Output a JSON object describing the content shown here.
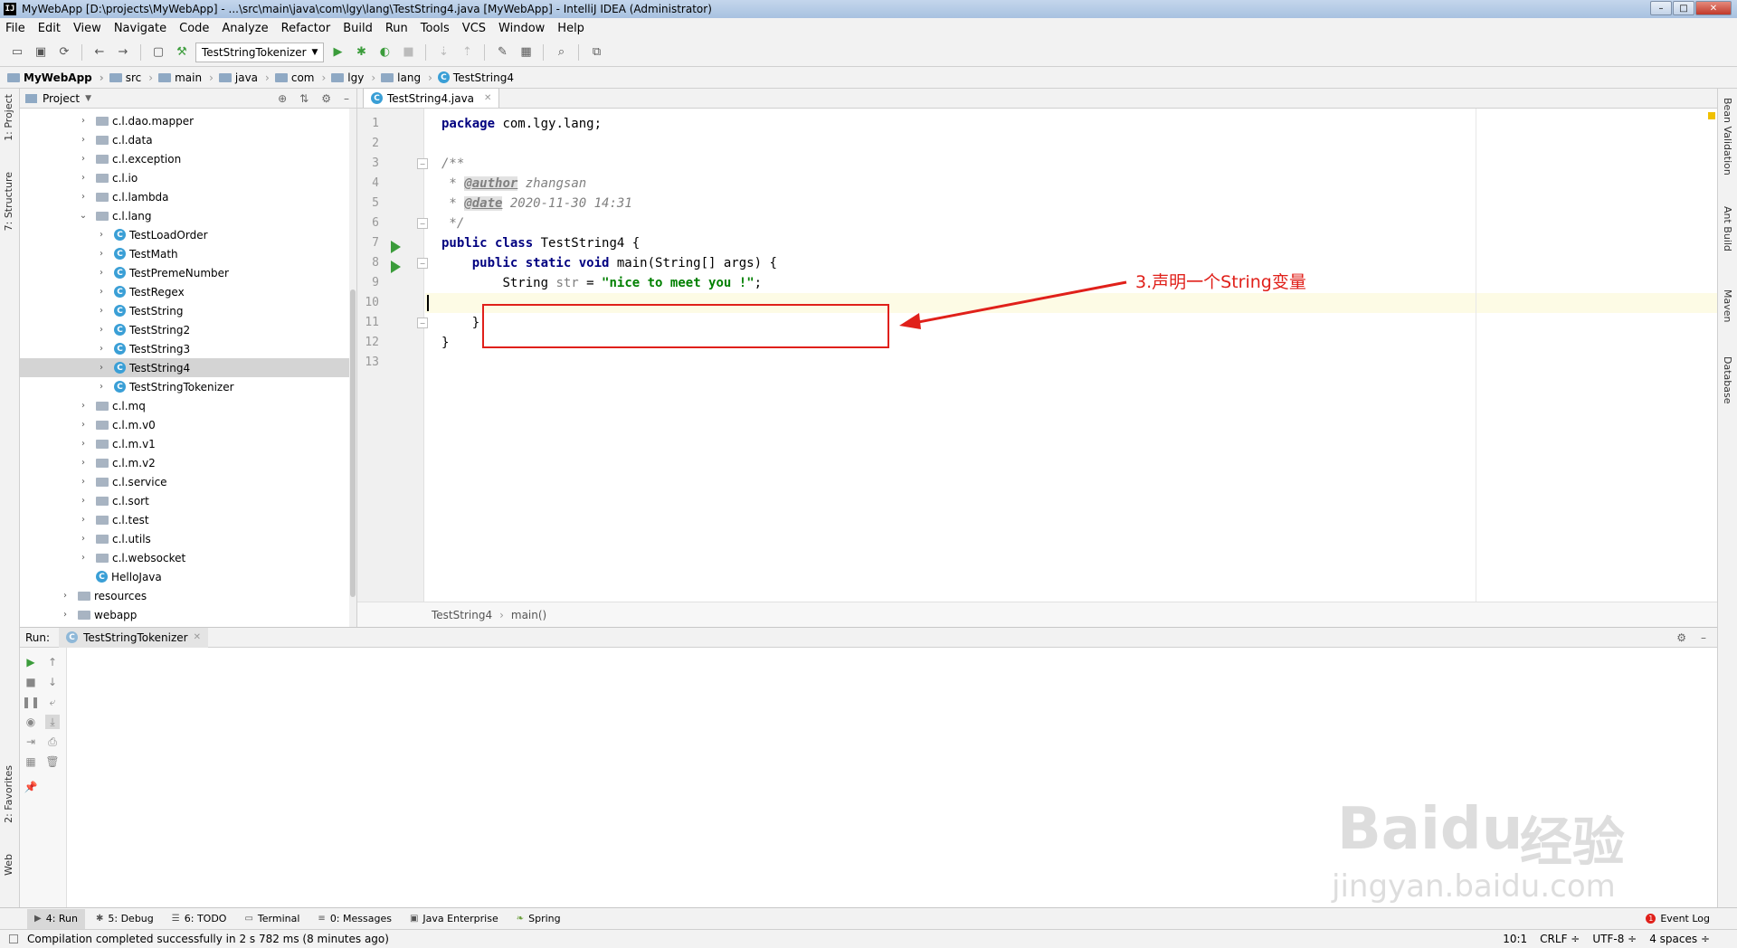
{
  "window": {
    "title": "MyWebApp [D:\\projects\\MyWebApp] - ...\\src\\main\\java\\com\\lgy\\lang\\TestString4.java [MyWebApp] - IntelliJ IDEA (Administrator)"
  },
  "menu": [
    "File",
    "Edit",
    "View",
    "Navigate",
    "Code",
    "Analyze",
    "Refactor",
    "Build",
    "Run",
    "Tools",
    "VCS",
    "Window",
    "Help"
  ],
  "toolbar": {
    "run_config": "TestStringTokenizer"
  },
  "breadcrumbs": [
    "MyWebApp",
    "src",
    "main",
    "java",
    "com",
    "lgy",
    "lang",
    "TestString4"
  ],
  "left_tabs": {
    "project": "1: Project",
    "structure": "7: Structure",
    "favorites": "2: Favorites",
    "web": "Web"
  },
  "right_tabs": [
    "Bean Validation",
    "Ant Build",
    "Maven",
    "Database"
  ],
  "project_panel": {
    "title": "Project",
    "items": [
      {
        "label": "c.l.dao.mapper",
        "type": "package",
        "indent": 1
      },
      {
        "label": "c.l.data",
        "type": "package",
        "indent": 1
      },
      {
        "label": "c.l.exception",
        "type": "package",
        "indent": 1
      },
      {
        "label": "c.l.io",
        "type": "package",
        "indent": 1
      },
      {
        "label": "c.l.lambda",
        "type": "package",
        "indent": 1
      },
      {
        "label": "c.l.lang",
        "type": "package",
        "indent": 1,
        "expanded": true
      },
      {
        "label": "TestLoadOrder",
        "type": "class",
        "indent": 2
      },
      {
        "label": "TestMath",
        "type": "class",
        "indent": 2
      },
      {
        "label": "TestPremeNumber",
        "type": "class",
        "indent": 2
      },
      {
        "label": "TestRegex",
        "type": "class",
        "indent": 2
      },
      {
        "label": "TestString",
        "type": "class",
        "indent": 2
      },
      {
        "label": "TestString2",
        "type": "class",
        "indent": 2
      },
      {
        "label": "TestString3",
        "type": "class",
        "indent": 2
      },
      {
        "label": "TestString4",
        "type": "class",
        "indent": 2,
        "selected": true
      },
      {
        "label": "TestStringTokenizer",
        "type": "class",
        "indent": 2
      },
      {
        "label": "c.l.mq",
        "type": "package",
        "indent": 1
      },
      {
        "label": "c.l.m.v0",
        "type": "package",
        "indent": 1
      },
      {
        "label": "c.l.m.v1",
        "type": "package",
        "indent": 1
      },
      {
        "label": "c.l.m.v2",
        "type": "package",
        "indent": 1
      },
      {
        "label": "c.l.service",
        "type": "package",
        "indent": 1
      },
      {
        "label": "c.l.sort",
        "type": "package",
        "indent": 1
      },
      {
        "label": "c.l.test",
        "type": "package",
        "indent": 1
      },
      {
        "label": "c.l.utils",
        "type": "package",
        "indent": 1
      },
      {
        "label": "c.l.websocket",
        "type": "package",
        "indent": 1
      },
      {
        "label": "HelloJava",
        "type": "class",
        "indent": 1,
        "nochevron": true
      },
      {
        "label": "resources",
        "type": "package",
        "indent": 0
      },
      {
        "label": "webapp",
        "type": "package",
        "indent": 0
      }
    ]
  },
  "editor": {
    "tab": "TestString4.java",
    "line_numbers": [
      "1",
      "2",
      "3",
      "4",
      "5",
      "6",
      "7",
      "8",
      "9",
      "10",
      "11",
      "12",
      "13"
    ],
    "code": {
      "l1_kw": "package",
      "l1_rest": " com.lgy.lang;",
      "l3": "/**",
      "l4_star": " * ",
      "l4_tag": "@author",
      "l4_rest": " zhangsan",
      "l5_star": " * ",
      "l5_tag": "@date",
      "l5_rest": " 2020-11-30 14:31",
      "l6": " */",
      "l7_kw": "public class",
      "l7_rest": " TestString4 {",
      "l8_pad": "    ",
      "l8_kw": "public static void",
      "l8_rest": " main(String[] args) {",
      "l9_pad": "        ",
      "l9_type": "String ",
      "l9_var": "str",
      "l9_eq": " = ",
      "l9_str": "\"nice to meet you !\"",
      "l9_end": ";",
      "l11": "    }",
      "l12": "}"
    },
    "crumbs": [
      "TestString4",
      "main()"
    ]
  },
  "annotation": {
    "text": "3.声明一个String变量",
    "color": "#e0201a"
  },
  "run_panel": {
    "label": "Run:",
    "tab": "TestStringTokenizer"
  },
  "bottom_tabs": [
    {
      "label": "4: Run",
      "icon": "play-icon"
    },
    {
      "label": "5: Debug",
      "icon": "debug-icon"
    },
    {
      "label": "6: TODO",
      "icon": "list-icon"
    },
    {
      "label": "Terminal",
      "icon": "terminal-icon"
    },
    {
      "label": "0: Messages",
      "icon": "messages-icon"
    },
    {
      "label": "Java Enterprise",
      "icon": "enterprise-icon"
    },
    {
      "label": "Spring",
      "icon": "spring-icon"
    }
  ],
  "event_log": "Event Log",
  "status": {
    "message": "Compilation completed successfully in 2 s 782 ms (8 minutes ago)",
    "position": "10:1",
    "line_sep": "CRLF ÷",
    "encoding": "UTF-8 ÷",
    "indent": "4 spaces ÷"
  },
  "watermark": {
    "brand": "Baidu",
    "cn": "经验",
    "url": "jingyan.baidu.com"
  }
}
